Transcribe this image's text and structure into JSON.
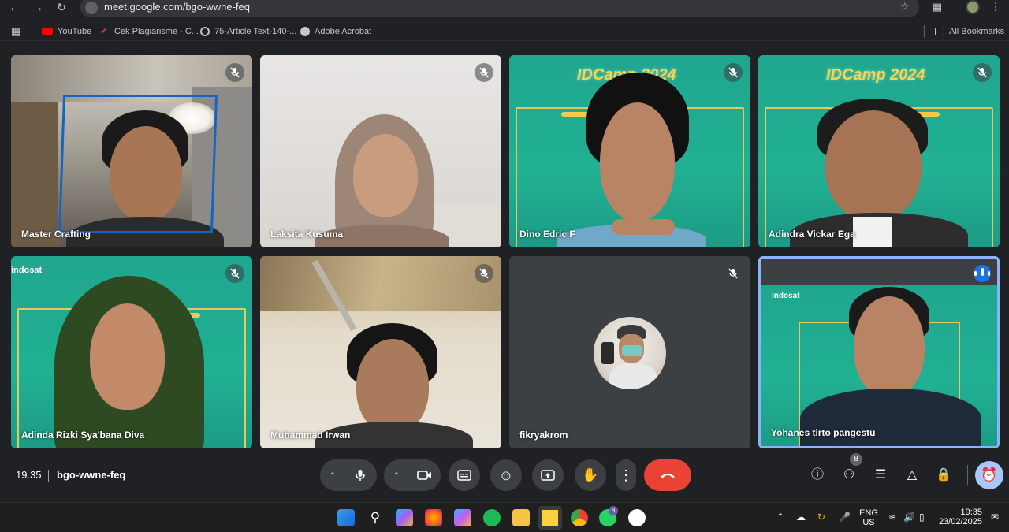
{
  "browser": {
    "url": "meet.google.com/bgo-wwne-feq",
    "bookmarks": [
      {
        "label": "YouTube",
        "icon": "youtube-icon"
      },
      {
        "label": "Cek Plagiarisme - C...",
        "icon": "check-icon"
      },
      {
        "label": "75-Article Text-140-...",
        "icon": "globe-icon"
      },
      {
        "label": "Adobe Acrobat",
        "icon": "acrobat-icon"
      }
    ],
    "all_bookmarks": "All Bookmarks"
  },
  "participants": [
    {
      "name": "Master Crafting",
      "muted": true
    },
    {
      "name": "Laksita Kusuma",
      "muted": true
    },
    {
      "name": "Dino Edric F",
      "muted": true
    },
    {
      "name": "Adindra Vickar Ega",
      "muted": true
    },
    {
      "name": "Adinda Rizki Sya'bana Diva",
      "muted": true
    },
    {
      "name": "Muhammad Irwan",
      "muted": true
    },
    {
      "name": "fikryakrom",
      "muted": true
    },
    {
      "name": "Yohanes tirto pangestu",
      "muted": false,
      "speaking": true
    }
  ],
  "banner": {
    "title": "IDCamp 2024",
    "brand": "indosat"
  },
  "meeting": {
    "time": "19.35",
    "code": "bgo-wwne-feq",
    "people_count": "8"
  },
  "taskbar": {
    "lang": "ENG",
    "region": "US",
    "time": "19:35",
    "date": "23/02/2025",
    "whatsapp_badge": "8"
  },
  "colors": {
    "end_call": "#ea4335",
    "active_speaker_border": "#8ab4f8",
    "banner_green": "#21b193"
  }
}
